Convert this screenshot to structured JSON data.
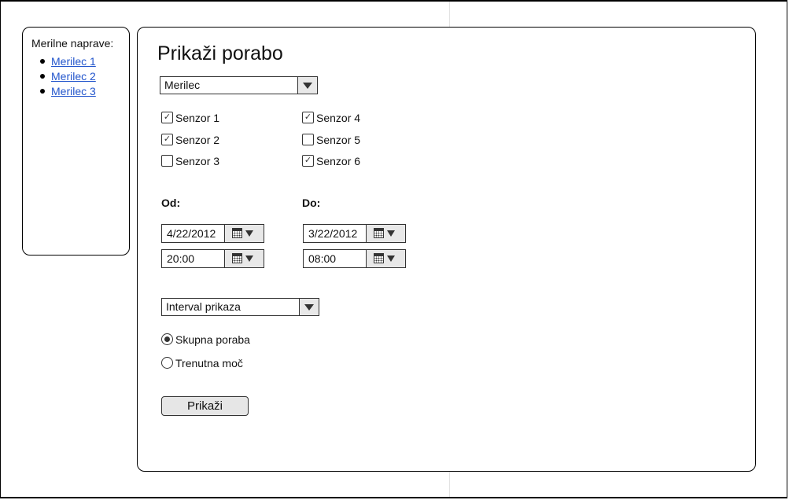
{
  "sidebar": {
    "title": "Merilne naprave:",
    "items": [
      {
        "label": "Merilec 1"
      },
      {
        "label": "Merilec 2"
      },
      {
        "label": "Merilec 3"
      }
    ]
  },
  "main": {
    "title": "Prikaži porabo",
    "meter_select": {
      "value": "Merilec"
    },
    "sensors": [
      {
        "label": "Senzor 1",
        "checked": true
      },
      {
        "label": "Senzor 2",
        "checked": true
      },
      {
        "label": "Senzor 3",
        "checked": false
      },
      {
        "label": "Senzor 4",
        "checked": true
      },
      {
        "label": "Senzor 5",
        "checked": false
      },
      {
        "label": "Senzor 6",
        "checked": true
      }
    ],
    "from": {
      "label": "Od:",
      "date": "4/22/2012",
      "time": "20:00"
    },
    "to": {
      "label": "Do:",
      "date": "3/22/2012",
      "time": "08:00"
    },
    "interval_select": {
      "value": "Interval prikaza"
    },
    "modes": [
      {
        "label": "Skupna poraba",
        "selected": true
      },
      {
        "label": "Trenutna moč",
        "selected": false
      }
    ],
    "submit_label": "Prikaži"
  },
  "icons": {
    "checkmark": "✓",
    "calendar": "calendar-icon",
    "dropdown": "chevron-down-icon"
  }
}
